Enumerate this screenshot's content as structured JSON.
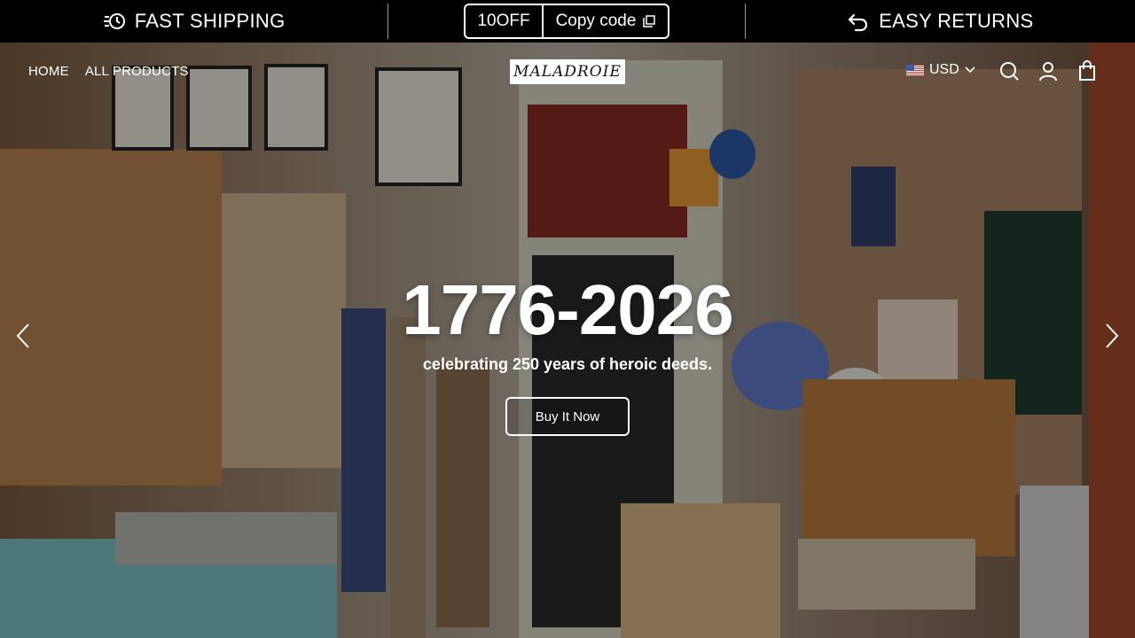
{
  "announcement": {
    "left_text": "FAST SHIPPING",
    "left_icon": "clock-speed-icon",
    "coupon_code": "10OFF",
    "copy_label": "Copy code",
    "copy_icon": "copy-icon",
    "right_text": "EASY RETURNS",
    "right_icon": "return-arrow-icon"
  },
  "header": {
    "nav": [
      "HOME",
      "ALL PRODUCTS"
    ],
    "logo": "MALADROIE",
    "currency": "USD",
    "icons": [
      "search-icon",
      "account-icon",
      "cart-icon"
    ]
  },
  "hero": {
    "headline": "1776-2026",
    "subline": "celebrating 250 years of heroic deeds.",
    "button_label": "Buy It Now",
    "photo": "shop-interior-photo"
  },
  "colors": {
    "bar_bg": "#000000",
    "text": "#ffffff",
    "overlay": "rgba(0,0,0,0.38)"
  }
}
